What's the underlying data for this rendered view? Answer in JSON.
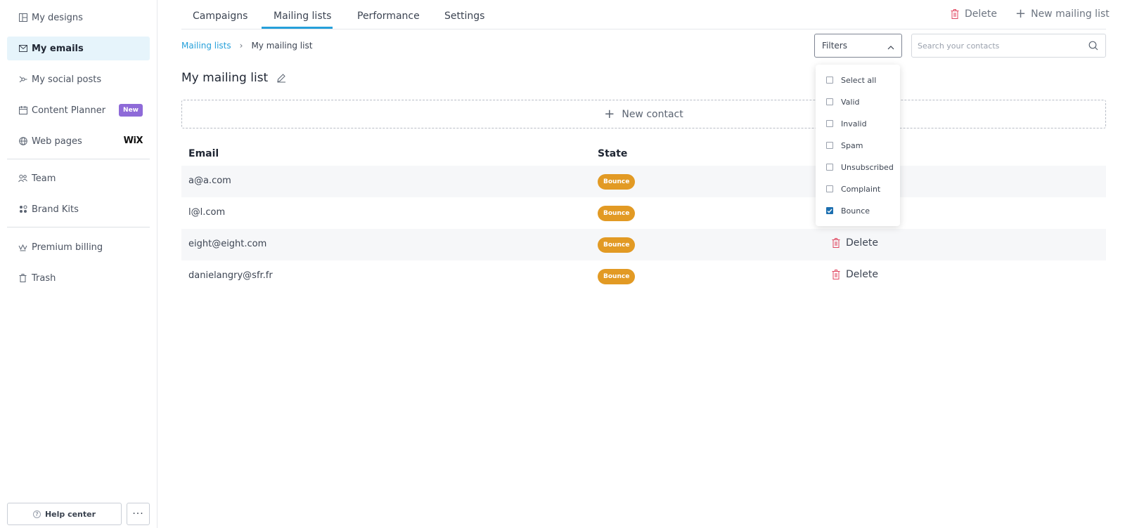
{
  "sidebar": {
    "items": [
      {
        "label": "My designs",
        "icon": "designs-icon"
      },
      {
        "label": "My emails",
        "icon": "mail-icon",
        "active": true
      },
      {
        "label": "My social posts",
        "icon": "social-icon"
      },
      {
        "label": "Content Planner",
        "icon": "calendar-icon",
        "badge": "New"
      },
      {
        "label": "Web pages",
        "icon": "globe-icon",
        "logo": "WiX"
      },
      {
        "label": "Team",
        "icon": "team-icon"
      },
      {
        "label": "Brand Kits",
        "icon": "brand-kits-icon"
      },
      {
        "label": "Premium billing",
        "icon": "crown-icon"
      },
      {
        "label": "Trash",
        "icon": "trash-icon"
      }
    ],
    "help_label": "Help center",
    "more_label": "···"
  },
  "tabs": [
    {
      "label": "Campaigns"
    },
    {
      "label": "Mailing lists",
      "active": true
    },
    {
      "label": "Performance"
    },
    {
      "label": "Settings"
    }
  ],
  "top_actions": {
    "delete_label": "Delete",
    "new_list_label": "New mailing list"
  },
  "breadcrumb": {
    "parent": "Mailing lists",
    "separator": "›",
    "current": "My mailing list"
  },
  "filters": {
    "label": "Filters",
    "options": [
      {
        "label": "Select all",
        "checked": false
      },
      {
        "label": "Valid",
        "checked": false
      },
      {
        "label": "Invalid",
        "checked": false
      },
      {
        "label": "Spam",
        "checked": false
      },
      {
        "label": "Unsubscribed",
        "checked": false
      },
      {
        "label": "Complaint",
        "checked": false
      },
      {
        "label": "Bounce",
        "checked": true
      }
    ]
  },
  "search": {
    "placeholder": "Search your contacts",
    "value": ""
  },
  "page_title": "My mailing list",
  "new_contact_label": "New contact",
  "table": {
    "headers": {
      "email": "Email",
      "state": "State"
    },
    "delete_label": "Delete",
    "rows": [
      {
        "email": "a@a.com",
        "state": "Bounce"
      },
      {
        "email": "l@l.com",
        "state": "Bounce"
      },
      {
        "email": "eight@eight.com",
        "state": "Bounce"
      },
      {
        "email": "danielangry@sfr.fr",
        "state": "Bounce"
      }
    ]
  },
  "colors": {
    "accent": "#26a0da",
    "active_nav_bg": "#e6f4fb",
    "badge_new": "#8e6ad8",
    "state_bounce": "#e29a24",
    "delete_red": "#e0455f",
    "checkbox_checked": "#1c6fb0"
  }
}
